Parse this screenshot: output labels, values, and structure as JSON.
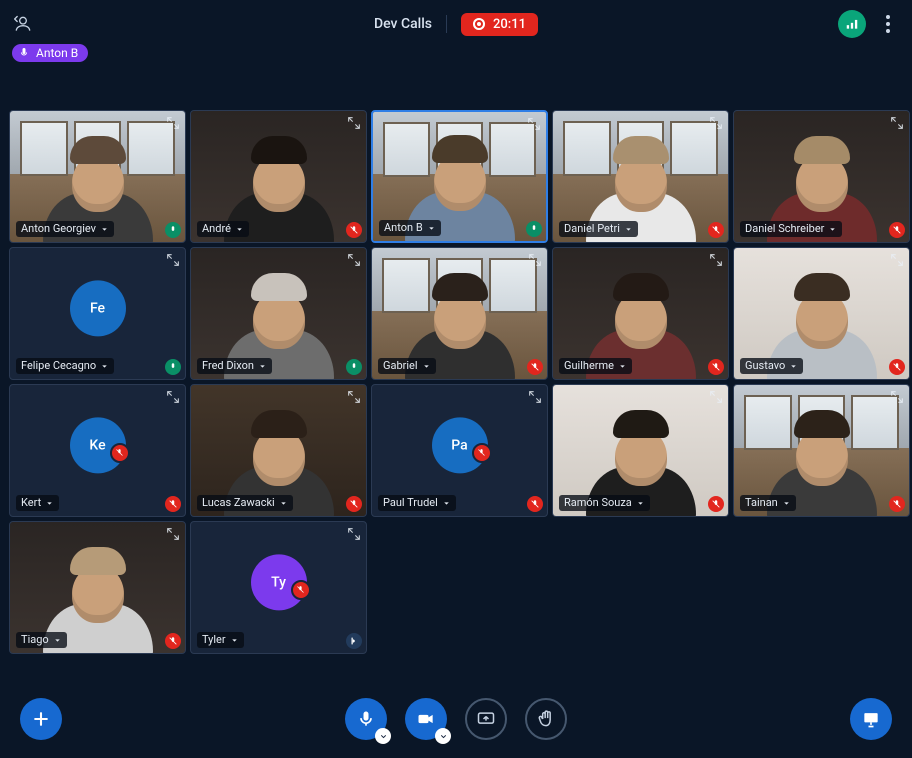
{
  "header": {
    "room_title": "Dev Calls",
    "recording_time": "20:11",
    "speaking_participant": "Anton B"
  },
  "participants": [
    {
      "name": "Anton Georgiev",
      "camera": true,
      "mic": "unmuted",
      "style": "room",
      "hair": "#5d4a3a",
      "shirt": "#3a3a3a"
    },
    {
      "name": "André",
      "camera": true,
      "mic": "muted",
      "style": "dark",
      "hair": "#1a1410",
      "shirt": "#1e1e1e"
    },
    {
      "name": "Anton B",
      "camera": true,
      "mic": "unmuted",
      "style": "room",
      "hair": "#4a3b2a",
      "shirt": "#6d84a0",
      "speaking": true
    },
    {
      "name": "Daniel Petri",
      "camera": true,
      "mic": "muted",
      "style": "room",
      "hair": "#a9906f",
      "shirt": "#e8e8e8"
    },
    {
      "name": "Daniel Schreiber",
      "camera": true,
      "mic": "muted",
      "style": "dark",
      "hair": "#a58b68",
      "shirt": "#6e2b2b"
    },
    {
      "name": "Felipe Cecagno",
      "camera": false,
      "mic": "unmuted",
      "initials": "Fe",
      "avatar_color": "blue"
    },
    {
      "name": "Fred Dixon",
      "camera": true,
      "mic": "unmuted",
      "style": "dark",
      "hair": "#c8c2bb",
      "shirt": "#6d6d6d"
    },
    {
      "name": "Gabriel",
      "camera": true,
      "mic": "muted",
      "style": "room",
      "hair": "#2a211b",
      "shirt": "#2f2f2f"
    },
    {
      "name": "Guilherme",
      "camera": true,
      "mic": "muted",
      "style": "dark",
      "hair": "#231a15",
      "shirt": "#6b2f2f"
    },
    {
      "name": "Gustavo",
      "camera": true,
      "mic": "muted",
      "style": "pale",
      "hair": "#3a2d22",
      "shirt": "#b9bfc5"
    },
    {
      "name": "Kert",
      "camera": false,
      "mic": "muted",
      "initials": "Ke",
      "avatar_color": "blue",
      "avatar_mute": true
    },
    {
      "name": "Lucas Zawacki",
      "camera": true,
      "mic": "muted",
      "style": "studio",
      "hair": "#2b2018",
      "shirt": "#333333"
    },
    {
      "name": "Paul Trudel",
      "camera": false,
      "mic": "muted",
      "initials": "Pa",
      "avatar_color": "blue",
      "avatar_mute": true
    },
    {
      "name": "Ramón Souza",
      "camera": true,
      "mic": "muted",
      "style": "pale",
      "hair": "#1f1a14",
      "shirt": "#1e1e1e"
    },
    {
      "name": "Tainan",
      "camera": true,
      "mic": "muted",
      "style": "room",
      "hair": "#2c2219",
      "shirt": "#3a3a3a"
    },
    {
      "name": "Tiago",
      "camera": true,
      "mic": "muted",
      "style": "dark",
      "hair": "#b69b78",
      "shirt": "#cfcfcf"
    },
    {
      "name": "Tyler",
      "camera": false,
      "mic": "listen",
      "initials": "Ty",
      "avatar_color": "purple",
      "avatar_mute": true
    }
  ]
}
